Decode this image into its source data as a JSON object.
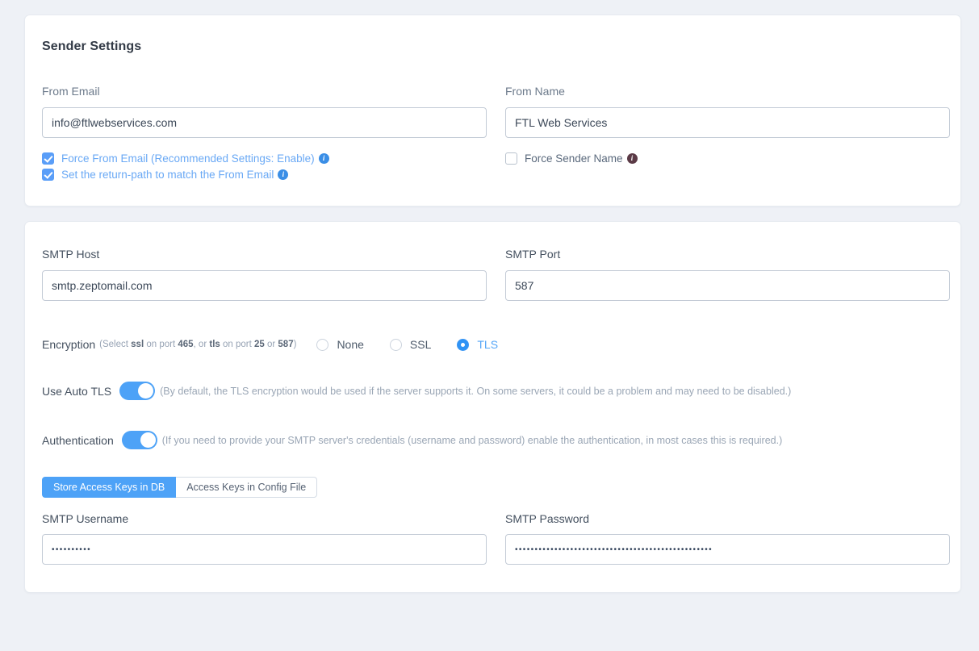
{
  "sender": {
    "title": "Sender Settings",
    "from_email": {
      "label": "From Email",
      "value": "info@ftlwebservices.com"
    },
    "from_name": {
      "label": "From Name",
      "value": "FTL Web Services"
    },
    "checkboxes_left": [
      {
        "label": "Force From Email (Recommended Settings: Enable)",
        "checked": true,
        "info_icon": "info-icon"
      },
      {
        "label": "Set the return-path to match the From Email",
        "checked": true,
        "info_icon": "info-icon"
      }
    ],
    "checkbox_right": {
      "label": "Force Sender Name",
      "checked": false,
      "info_icon": "info-icon"
    }
  },
  "smtp": {
    "host": {
      "label": "SMTP Host",
      "value": "smtp.zeptomail.com"
    },
    "port": {
      "label": "SMTP Port",
      "value": "587"
    },
    "encryption": {
      "label": "Encryption",
      "hint_prefix": "(Select ",
      "hint_b1": "ssl",
      "hint_mid1": " on port ",
      "hint_b2": "465",
      "hint_mid2": ", or ",
      "hint_b3": "tls",
      "hint_mid3": " on port ",
      "hint_b4": "25",
      "hint_mid4": " or ",
      "hint_b5": "587",
      "hint_suffix": ")",
      "options": [
        {
          "label": "None",
          "selected": false
        },
        {
          "label": "SSL",
          "selected": false
        },
        {
          "label": "TLS",
          "selected": true
        }
      ]
    },
    "auto_tls": {
      "label": "Use Auto TLS",
      "on": true,
      "hint": "(By default, the TLS encryption would be used if the server supports it. On some servers, it could be a problem and may need to be disabled.)"
    },
    "authentication": {
      "label": "Authentication",
      "on": true,
      "hint": "(If you need to provide your SMTP server's credentials (username and password) enable the authentication, in most cases this is required.)"
    },
    "tabs": [
      {
        "label": "Store Access Keys in DB",
        "active": true
      },
      {
        "label": "Access Keys in Config File",
        "active": false
      }
    ],
    "username": {
      "label": "SMTP Username",
      "value": "••••••••••"
    },
    "password": {
      "label": "SMTP Password",
      "value": "••••••••••••••••••••••••••••••••••••••••••••••••••"
    }
  },
  "colors": {
    "accent": "#4da2f7",
    "link": "#6aa9f5",
    "page_bg": "#eef1f6",
    "card_bg": "#ffffff",
    "border": "#c3cbd6",
    "text": "#44505f",
    "muted": "#97a3b4"
  }
}
